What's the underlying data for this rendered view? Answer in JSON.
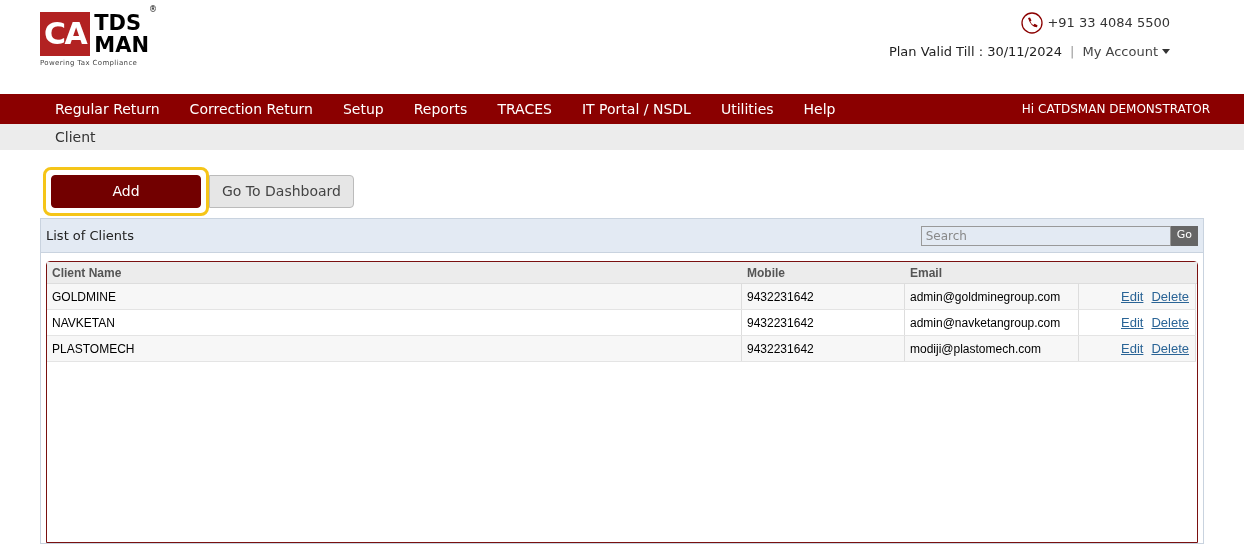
{
  "logo": {
    "mark": "CA",
    "name_top": "TDS",
    "name_bottom": "MAN",
    "registered": "®",
    "tagline": "Powering Tax Compliance"
  },
  "header": {
    "phone": "+91 33 4084 5500",
    "plan": "Plan Valid Till : 30/11/2024",
    "separator": "|",
    "account": "My Account"
  },
  "nav": {
    "items": [
      "Regular Return",
      "Correction Return",
      "Setup",
      "Reports",
      "TRACES",
      "IT Portal / NSDL",
      "Utilities",
      "Help"
    ],
    "greeting": "Hi CATDSMAN DEMONSTRATOR"
  },
  "breadcrumb": "Client",
  "buttons": [
    {
      "label": "Add",
      "kind": "primary",
      "highlighted": true
    },
    {
      "label": "Go To Dashboard",
      "kind": "secondary",
      "highlighted": false
    }
  ],
  "panel": {
    "title": "List of Clients",
    "search": {
      "placeholder": "Search",
      "button": "Go"
    }
  },
  "table": {
    "columns": [
      "Client Name",
      "Mobile",
      "Email"
    ],
    "rows": [
      {
        "name": "GOLDMINE",
        "mobile": "9432231642",
        "email": "admin@goldminegroup.com",
        "actions": [
          "Edit",
          "Delete"
        ]
      },
      {
        "name": "NAVKETAN",
        "mobile": "9432231642",
        "email": "admin@navketangroup.com",
        "actions": [
          "Edit",
          "Delete"
        ]
      },
      {
        "name": "PLASTOMECH",
        "mobile": "9432231642",
        "email": "modiji@plastomech.com",
        "actions": [
          "Edit",
          "Delete"
        ]
      }
    ]
  }
}
